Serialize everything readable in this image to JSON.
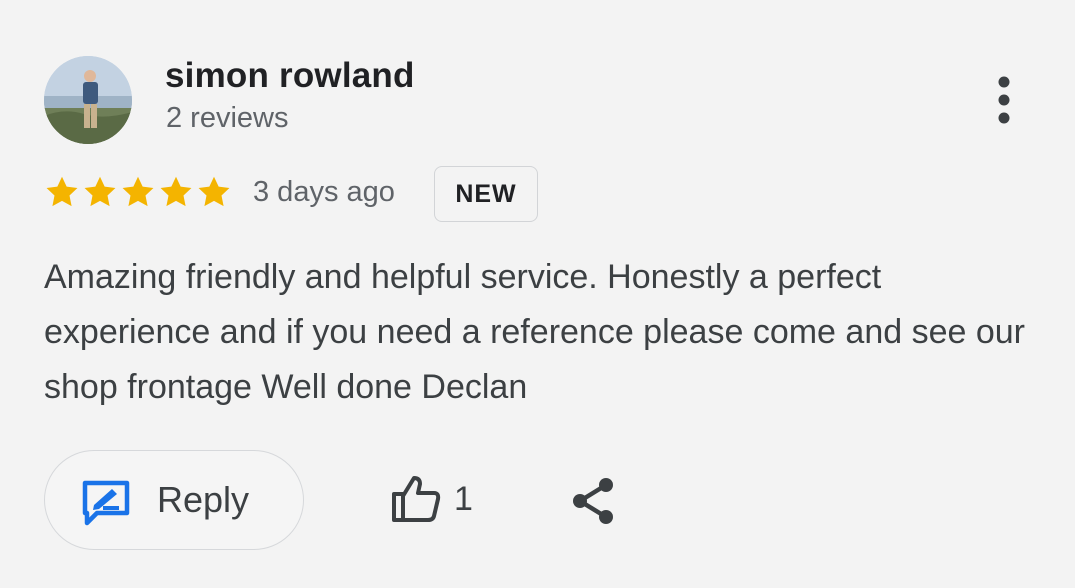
{
  "reviewer": {
    "name": "simon rowland",
    "review_count": "2 reviews",
    "avatar_icon": "profile-photo"
  },
  "rating": {
    "stars": 5,
    "max": 5,
    "color": "#f4b400"
  },
  "meta": {
    "time_ago": "3 days ago",
    "badge": "NEW"
  },
  "review": {
    "text": "Amazing friendly and helpful service. Honestly a perfect experience and if you need a reference please come and see our shop frontage Well done Declan"
  },
  "actions": {
    "reply_label": "Reply",
    "reply_icon": "reply-edit-icon",
    "reply_icon_color": "#1a73e8",
    "like_icon": "thumbs-up-icon",
    "like_count": "1",
    "share_icon": "share-icon",
    "more_icon": "more-vertical-icon"
  }
}
